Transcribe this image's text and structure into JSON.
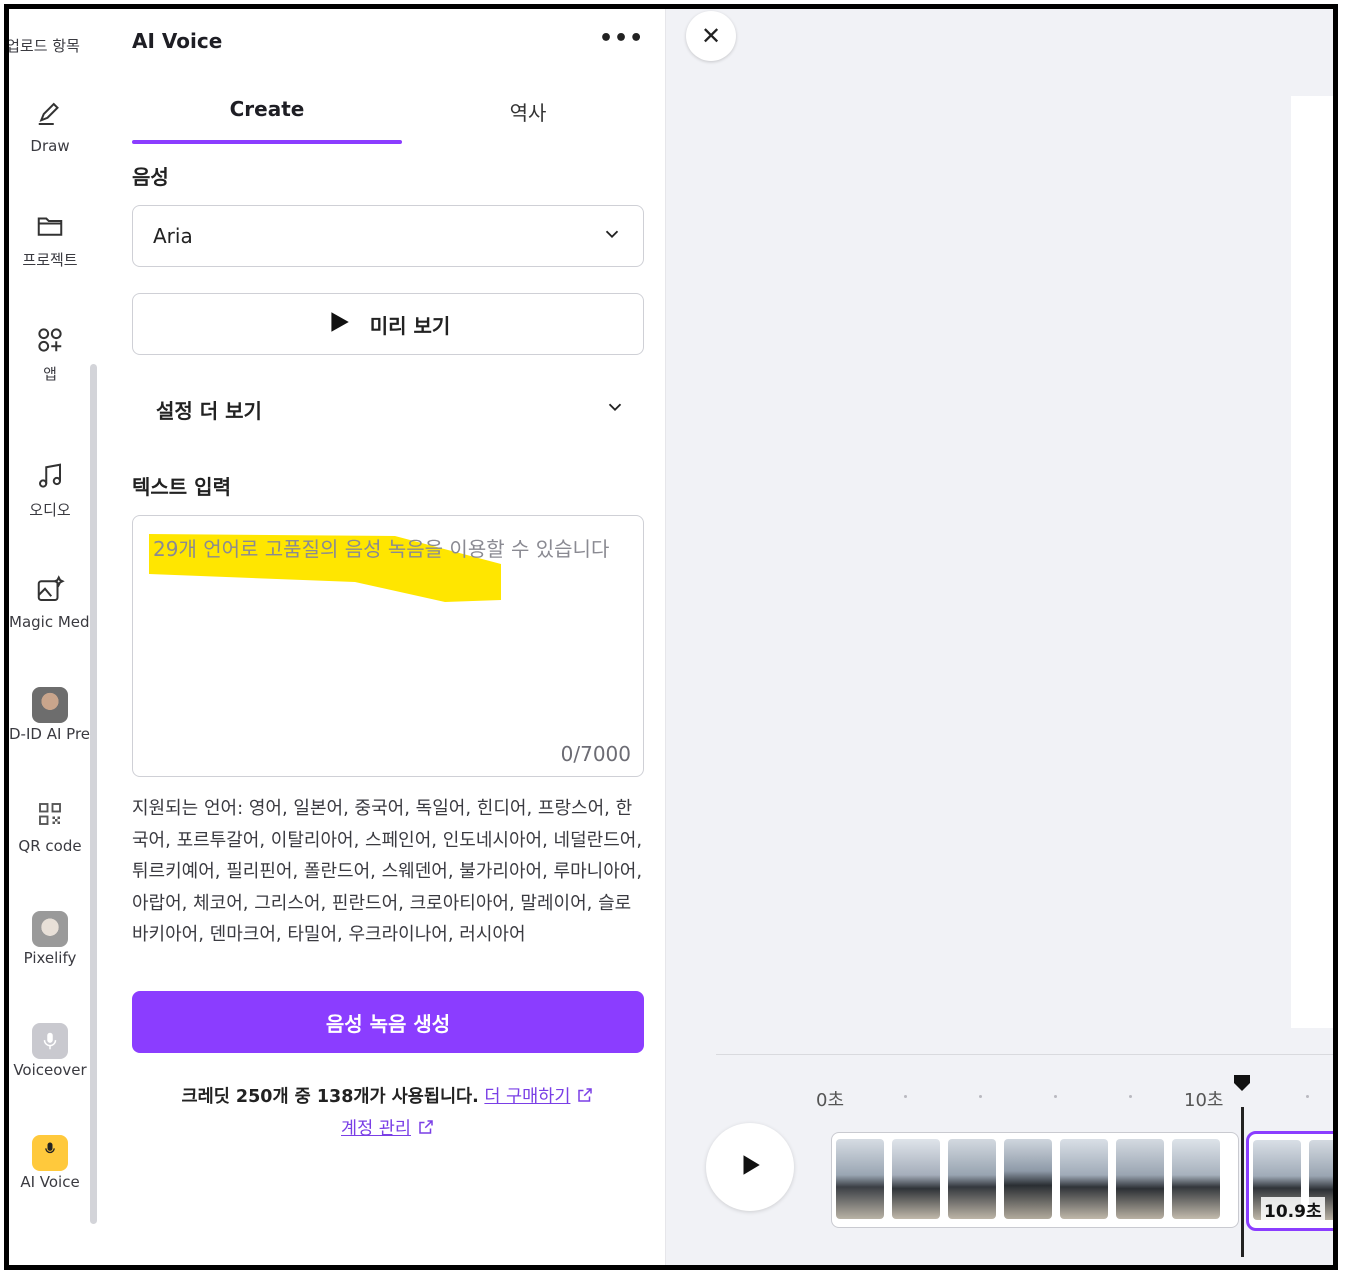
{
  "rail": {
    "items": [
      {
        "label": "업로드 항목",
        "icon": "upload-icon"
      },
      {
        "label": "Draw",
        "icon": "draw-pen-icon"
      },
      {
        "label": "프로젝트",
        "icon": "folder-icon"
      },
      {
        "label": "앱",
        "icon": "apps-grid-icon"
      },
      {
        "label": "오디오",
        "icon": "music-note-icon"
      },
      {
        "label": "Magic Media",
        "icon": "magic-media-icon"
      },
      {
        "label": "D-ID AI Pre...",
        "icon": "d-id-avatar-icon"
      },
      {
        "label": "QR code",
        "icon": "qr-code-icon"
      },
      {
        "label": "Pixelify",
        "icon": "pixelify-icon"
      },
      {
        "label": "Voiceover",
        "icon": "voiceover-mic-icon"
      },
      {
        "label": "AI Voice",
        "icon": "ai-voice-icon"
      }
    ]
  },
  "panel": {
    "title": "AI Voice",
    "more_label": "•••",
    "tabs": [
      {
        "label": "Create",
        "active": true
      },
      {
        "label": "역사",
        "active": false
      }
    ],
    "voice_label": "음성",
    "voice_value": "Aria",
    "preview_label": "미리 보기",
    "more_settings_label": "설정 더 보기",
    "text_input_label": "텍스트 입력",
    "text_placeholder": "29개 언어로 고품질의 음성 녹음을 이용할 수 있습니다",
    "text_counter": "0/7000",
    "supported_languages": "지원되는 언어: 영어, 일본어, 중국어, 독일어, 힌디어, 프랑스어, 한국어, 포르투갈어, 이탈리아어, 스페인어, 인도네시아어, 네덜란드어, 튀르키예어, 필리핀어, 폴란드어, 스웨덴어, 불가리아어, 루마니아어, 아랍어, 체코어, 그리스어, 핀란드어, 크로아티아어, 말레이어, 슬로바키아어, 덴마크어, 타밀어, 우크라이나어, 러시아어",
    "generate_label": "음성 녹음 생성",
    "credits_text": "크레딧 250개 중 138개가 사용됩니다.",
    "buy_more_label": "더 구매하기",
    "manage_account_label": "계정 관리"
  },
  "canvas": {
    "close_label": "✕",
    "timeline": {
      "tick_start": "0초",
      "tick_mid": "10초",
      "clip_duration": "10.9초"
    }
  },
  "colors": {
    "accent": "#8b3dff",
    "highlight": "#ffe600"
  }
}
